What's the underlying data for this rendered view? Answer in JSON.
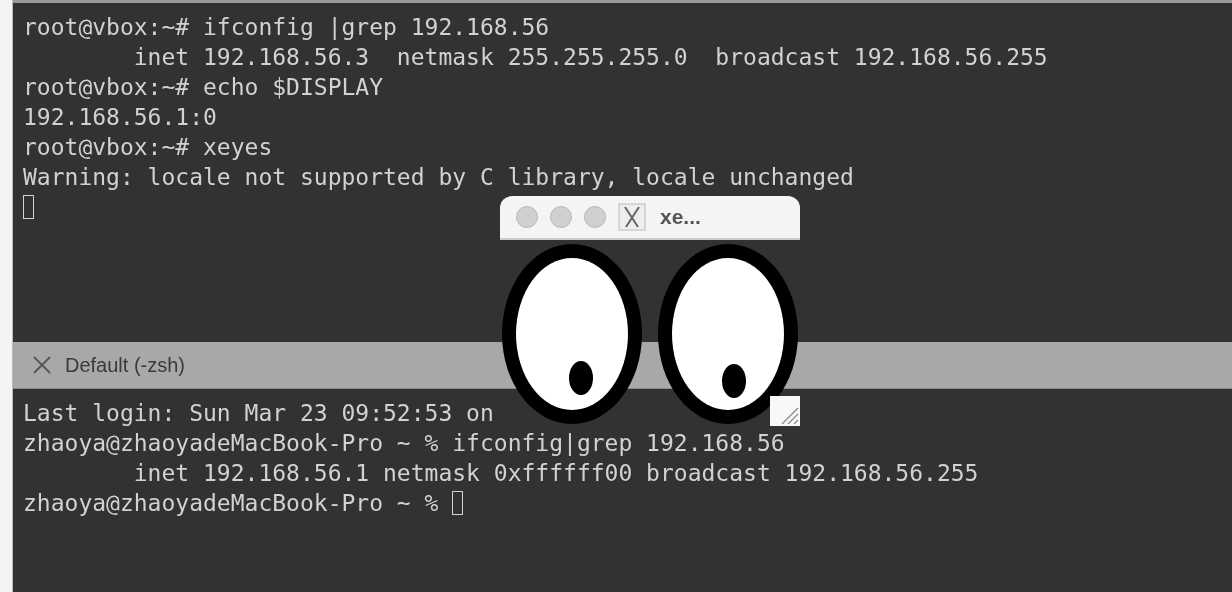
{
  "top_terminal": {
    "lines": [
      {
        "text": "root@vbox:~# ifconfig |grep 192.168.56",
        "cursor": false
      },
      {
        "text": "        inet 192.168.56.3  netmask 255.255.255.0  broadcast 192.168.56.255",
        "cursor": false
      },
      {
        "text": "root@vbox:~# echo $DISPLAY",
        "cursor": false
      },
      {
        "text": "192.168.56.1:0",
        "cursor": false
      },
      {
        "text": "root@vbox:~# xeyes",
        "cursor": false
      },
      {
        "text": "Warning: locale not supported by C library, locale unchanged",
        "cursor": false
      },
      {
        "cursor": true
      }
    ]
  },
  "tab": {
    "title": "Default (-zsh)"
  },
  "bottom_terminal": {
    "lines": [
      {
        "text": "Last login: Sun Mar 23 09:52:53 on",
        "cursor": false
      },
      {
        "text": "zhaoya@zhaoyadeMacBook-Pro ~ % ifconfig|grep 192.168.56",
        "cursor": false
      },
      {
        "text": "        inet 192.168.56.1 netmask 0xffffff00 broadcast 192.168.56.255",
        "cursor": false
      },
      {
        "text": "zhaoya@zhaoyadeMacBook-Pro ~ %",
        "cursor": true
      }
    ]
  },
  "xeyes_window": {
    "title": "xe..."
  }
}
